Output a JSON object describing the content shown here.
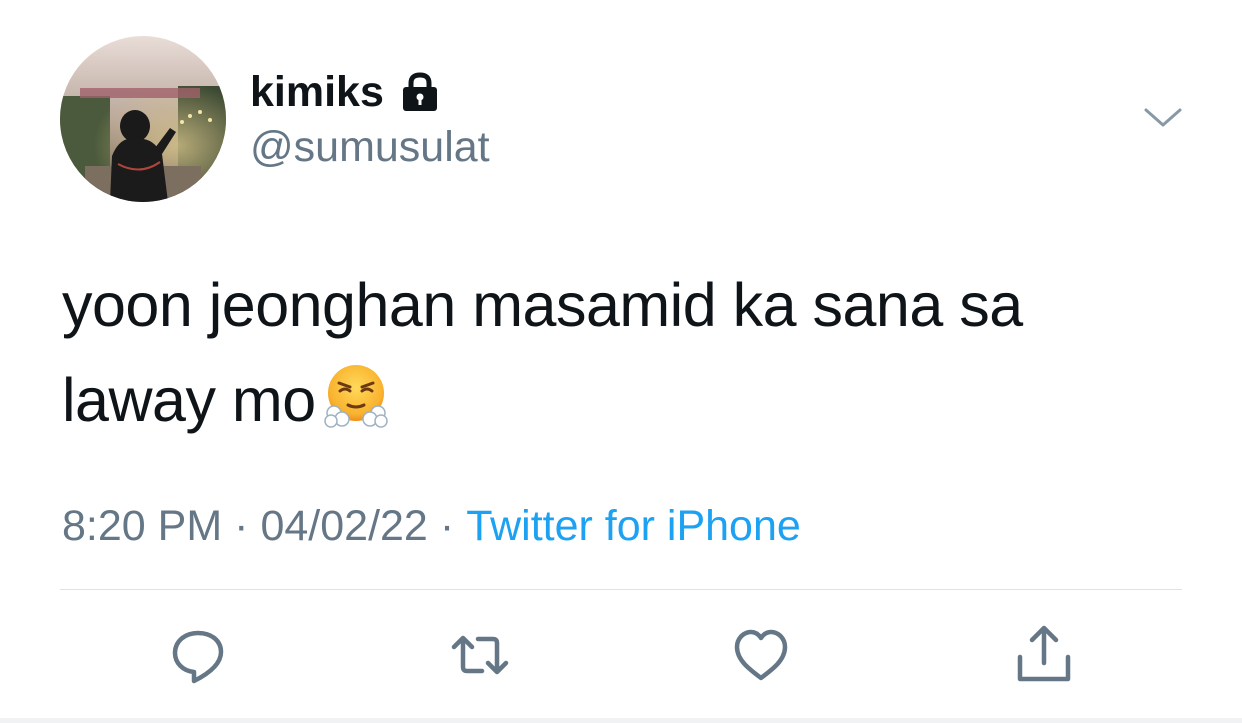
{
  "user": {
    "display_name": "kimiks",
    "handle": "@sumusulat",
    "protected_icon": "lock-icon"
  },
  "tweet": {
    "text_line1": "yoon jeonghan masamid ka sana sa",
    "text_line2": "laway mo",
    "emoji": "face-with-steam-from-nose"
  },
  "meta": {
    "time": "8:20 PM",
    "separator": "·",
    "date": "04/02/22",
    "source": "Twitter for iPhone"
  },
  "actions": [
    "reply-icon",
    "retweet-icon",
    "like-icon",
    "share-icon"
  ],
  "colors": {
    "text": "#0f1419",
    "secondary": "#657786",
    "link": "#1da1f2",
    "divider": "#dfe3e6"
  }
}
